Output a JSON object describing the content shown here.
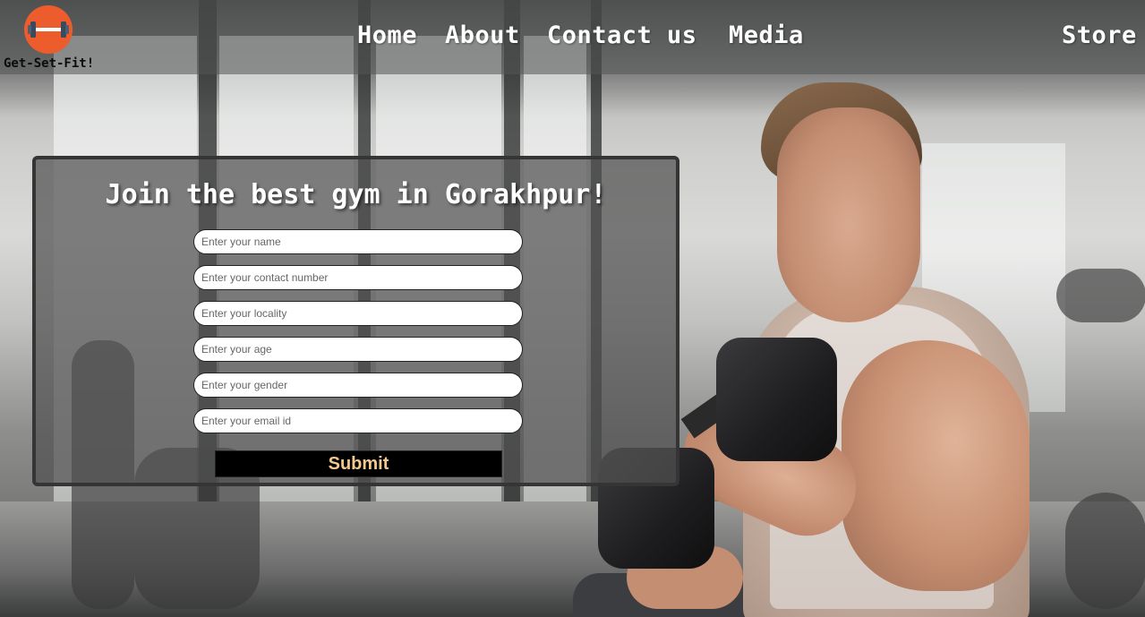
{
  "brand": {
    "name": "Get-Set-Fit!",
    "logo_icon": "dumbbell-icon",
    "logo_color": "#ec5c2c"
  },
  "nav": {
    "home": "Home",
    "about": "About",
    "contact": "Contact us",
    "media": "Media",
    "store": "Store"
  },
  "form": {
    "title": "Join the best gym in Gorakhpur!",
    "fields": [
      {
        "placeholder": "Enter your name",
        "value": ""
      },
      {
        "placeholder": "Enter your contact number",
        "value": ""
      },
      {
        "placeholder": "Enter your locality",
        "value": ""
      },
      {
        "placeholder": "Enter your age",
        "value": ""
      },
      {
        "placeholder": "Enter your gender",
        "value": ""
      },
      {
        "placeholder": "Enter your email id",
        "value": ""
      }
    ],
    "submit_label": "Submit",
    "submit_text_color": "#f4c98f"
  }
}
